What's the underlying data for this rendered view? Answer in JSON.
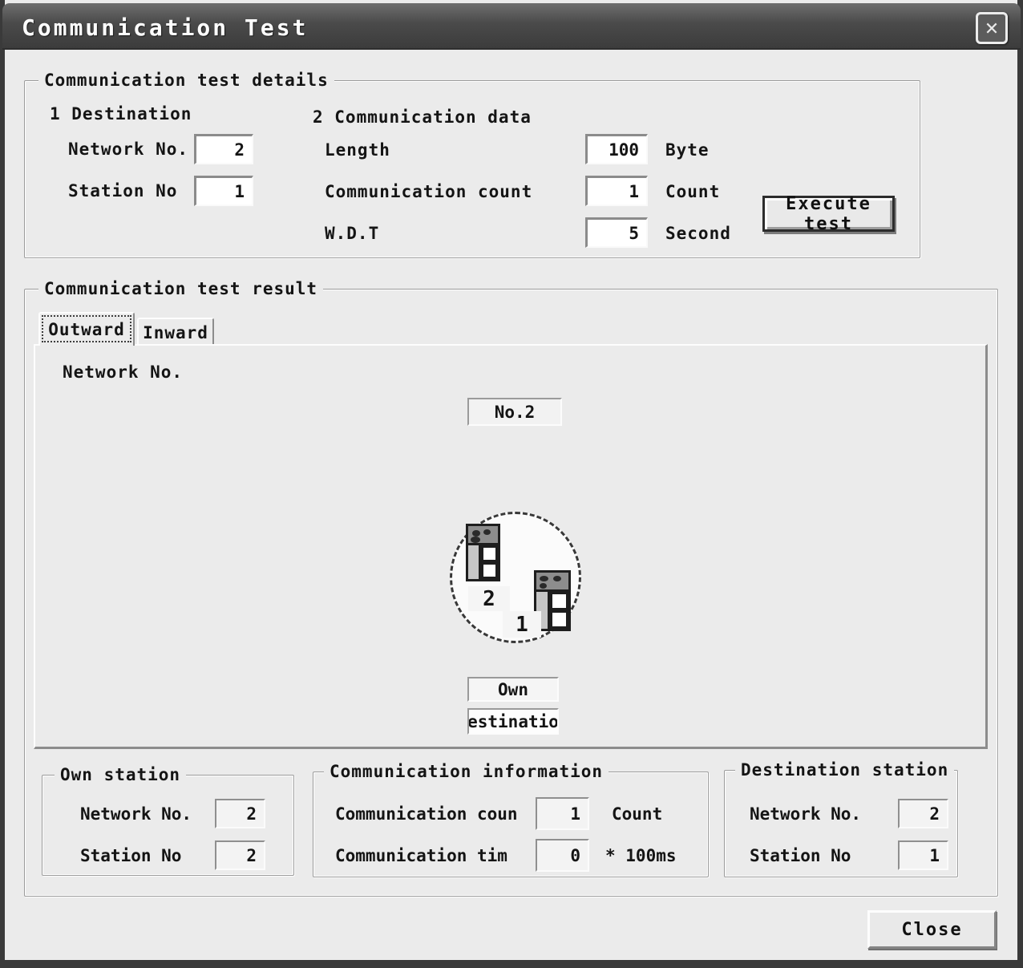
{
  "window": {
    "title": "Communication Test",
    "close_glyph": "✕"
  },
  "details": {
    "legend": "Communication test details",
    "destination": {
      "heading": "1 Destination",
      "network_label": "Network No.",
      "network_value": "2",
      "station_label": "Station No",
      "station_value": "1"
    },
    "comm_data": {
      "heading": "2 Communication data",
      "rows": [
        {
          "label": "Length",
          "value": "100",
          "unit": "Byte"
        },
        {
          "label": "Communication count",
          "value": "1",
          "unit": "Count"
        },
        {
          "label": "W.D.T",
          "value": "5",
          "unit": "Second"
        }
      ]
    },
    "execute_button": "Execute test"
  },
  "result": {
    "legend": "Communication test result",
    "tabs": [
      {
        "label": "Outward"
      },
      {
        "label": "Inward"
      }
    ],
    "network_label": "Network No.",
    "network_badge": "No.2",
    "diagram": {
      "station_top": "2",
      "station_right": "1",
      "own_label": "Own",
      "destination_label": "estinatio"
    },
    "own_station": {
      "legend": "Own station",
      "network_label": "Network No.",
      "network_value": "2",
      "station_label": "Station No",
      "station_value": "2"
    },
    "comm_info": {
      "legend": "Communication information",
      "rows": [
        {
          "label": "Communication coun",
          "value": "1",
          "unit": "Count"
        },
        {
          "label": "Communication tim",
          "value": "0",
          "unit": "* 100ms"
        }
      ]
    },
    "dest_station": {
      "legend": "Destination station",
      "network_label": "Network No.",
      "network_value": "2",
      "station_label": "Station No",
      "station_value": "1"
    }
  },
  "footer": {
    "close_button": "Close"
  }
}
